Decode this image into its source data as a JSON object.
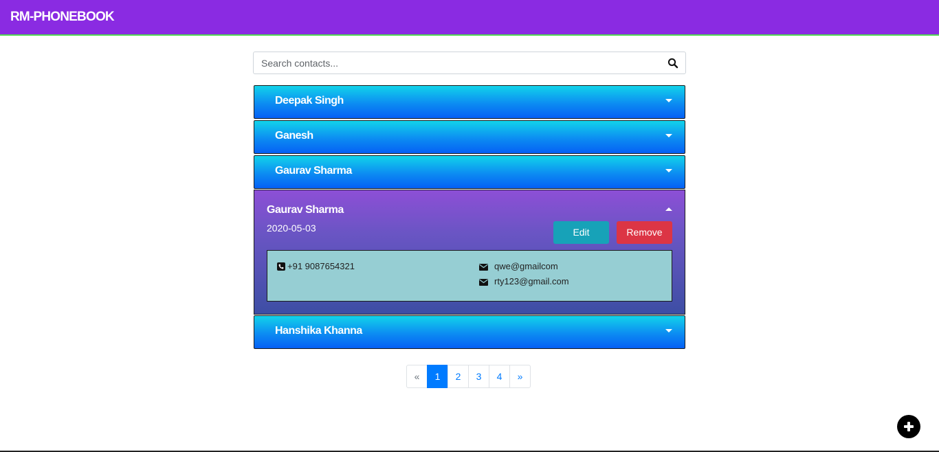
{
  "app": {
    "brand": "RM-PHONEBOOK"
  },
  "search": {
    "placeholder": "Search contacts..."
  },
  "contacts": [
    {
      "name": "Deepak Singh"
    },
    {
      "name": "Ganesh"
    },
    {
      "name": "Gaurav Sharma"
    },
    {
      "name": "Hanshika Khanna"
    }
  ],
  "expanded": {
    "name": "Gaurav Sharma",
    "date": "2020-05-03",
    "phone": "+91 9087654321",
    "emails": [
      "qwe@gmailcom",
      "rty123@gmail.com"
    ],
    "edit_label": "Edit",
    "remove_label": "Remove"
  },
  "pagination": {
    "prev": "«",
    "pages": [
      "1",
      "2",
      "3",
      "4"
    ],
    "next": "»",
    "active": "1"
  },
  "colors": {
    "navbar": "#8a2be2",
    "edit": "#17a2b8",
    "remove": "#dc3545",
    "page_active": "#007bff"
  },
  "icons": {
    "search": "search-icon",
    "caret_down": "caret-down-icon",
    "caret_up": "caret-up-icon",
    "phone": "phone-icon",
    "email": "envelope-icon",
    "add": "plus-icon"
  }
}
